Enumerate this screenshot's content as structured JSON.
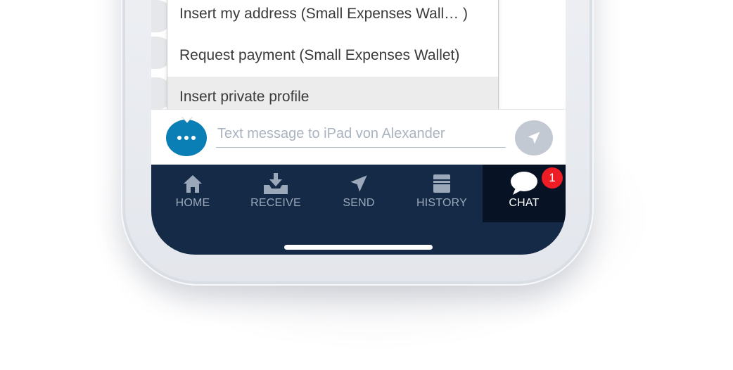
{
  "menu": {
    "items": [
      {
        "label": "Insert my address (Small Expenses Wall… )",
        "selected": false
      },
      {
        "label": "Request payment (Small Expenses Wallet)",
        "selected": false
      },
      {
        "label": "Insert private profile",
        "selected": true
      }
    ]
  },
  "composer": {
    "more_icon": "more-dots-icon",
    "placeholder": "Text message to iPad von Alexander",
    "value": "",
    "send_icon": "paper-plane-icon"
  },
  "tabbar": {
    "tabs": [
      {
        "label": "HOME",
        "icon": "home-icon",
        "active": false
      },
      {
        "label": "RECEIVE",
        "icon": "download-icon",
        "active": false
      },
      {
        "label": "SEND",
        "icon": "paper-plane-icon",
        "active": false
      },
      {
        "label": "HISTORY",
        "icon": "archive-icon",
        "active": false
      },
      {
        "label": "CHAT",
        "icon": "chat-bubble-icon",
        "active": true
      }
    ],
    "chat_badge": "1"
  },
  "colors": {
    "accent": "#0a7fb5",
    "tabbar_bg": "#142a46",
    "tab_active_bg": "#071324",
    "badge": "#ee1c25",
    "send_disabled": "#c3c9d2"
  }
}
